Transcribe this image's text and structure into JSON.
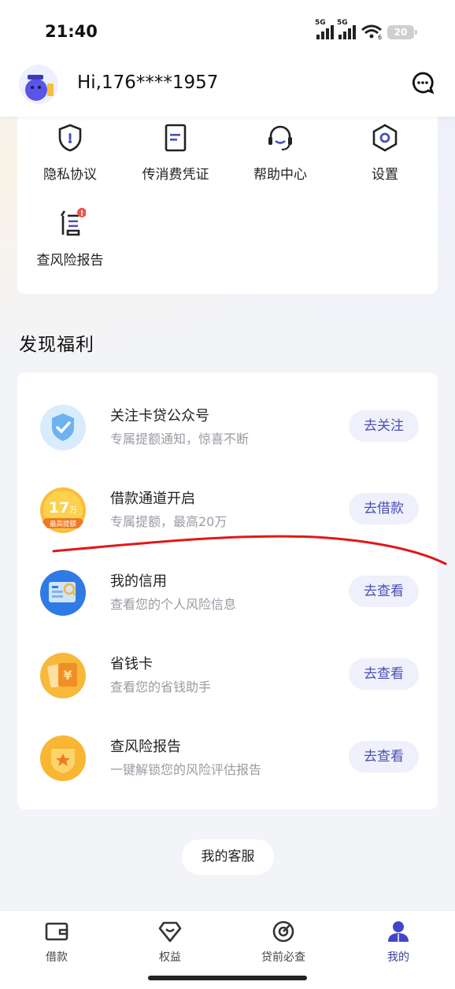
{
  "status_bar": {
    "time": "21:40",
    "signal1": "5G",
    "signal2": "5G",
    "wifi_label": "6",
    "battery": "20"
  },
  "header": {
    "greeting": "Hi,176****1957"
  },
  "menu": {
    "items": [
      {
        "label": "隐私协议",
        "icon": "shield-icon"
      },
      {
        "label": "传消费凭证",
        "icon": "document-icon"
      },
      {
        "label": "帮助中心",
        "icon": "headset-icon"
      },
      {
        "label": "设置",
        "icon": "gear-icon"
      },
      {
        "label": "查风险报告",
        "icon": "credit-report-icon",
        "badge": "!"
      }
    ]
  },
  "benefits": {
    "title": "发现福利",
    "items": [
      {
        "title": "关注卡贷公众号",
        "subtitle": "专属提额通知，惊喜不断",
        "button": "去关注",
        "icon": "shield-check-icon"
      },
      {
        "title": "借款通道开启",
        "subtitle": "专属提额，最高20万",
        "button": "去借款",
        "icon": "amount-badge-icon",
        "badge_amount": "17",
        "badge_unit": "万",
        "badge_caption": "最高提额"
      },
      {
        "title": "我的信用",
        "subtitle": "查看您的个人风险信息",
        "button": "去查看",
        "icon": "credit-screen-icon"
      },
      {
        "title": "省钱卡",
        "subtitle": "查看您的省钱助手",
        "button": "去查看",
        "icon": "yuan-card-icon"
      },
      {
        "title": "查风险报告",
        "subtitle": "一键解锁您的风险评估报告",
        "button": "去查看",
        "icon": "star-report-icon"
      }
    ]
  },
  "service_button": "我的客服",
  "bottom_nav": {
    "items": [
      {
        "label": "借款",
        "icon": "wallet-icon"
      },
      {
        "label": "权益",
        "icon": "diamond-icon"
      },
      {
        "label": "贷前必查",
        "icon": "target-icon"
      },
      {
        "label": "我的",
        "icon": "user-icon",
        "active": true
      }
    ]
  },
  "colors": {
    "accent": "#4a4fb7",
    "button_bg": "#eff0fb",
    "annotation": "#e01818"
  }
}
